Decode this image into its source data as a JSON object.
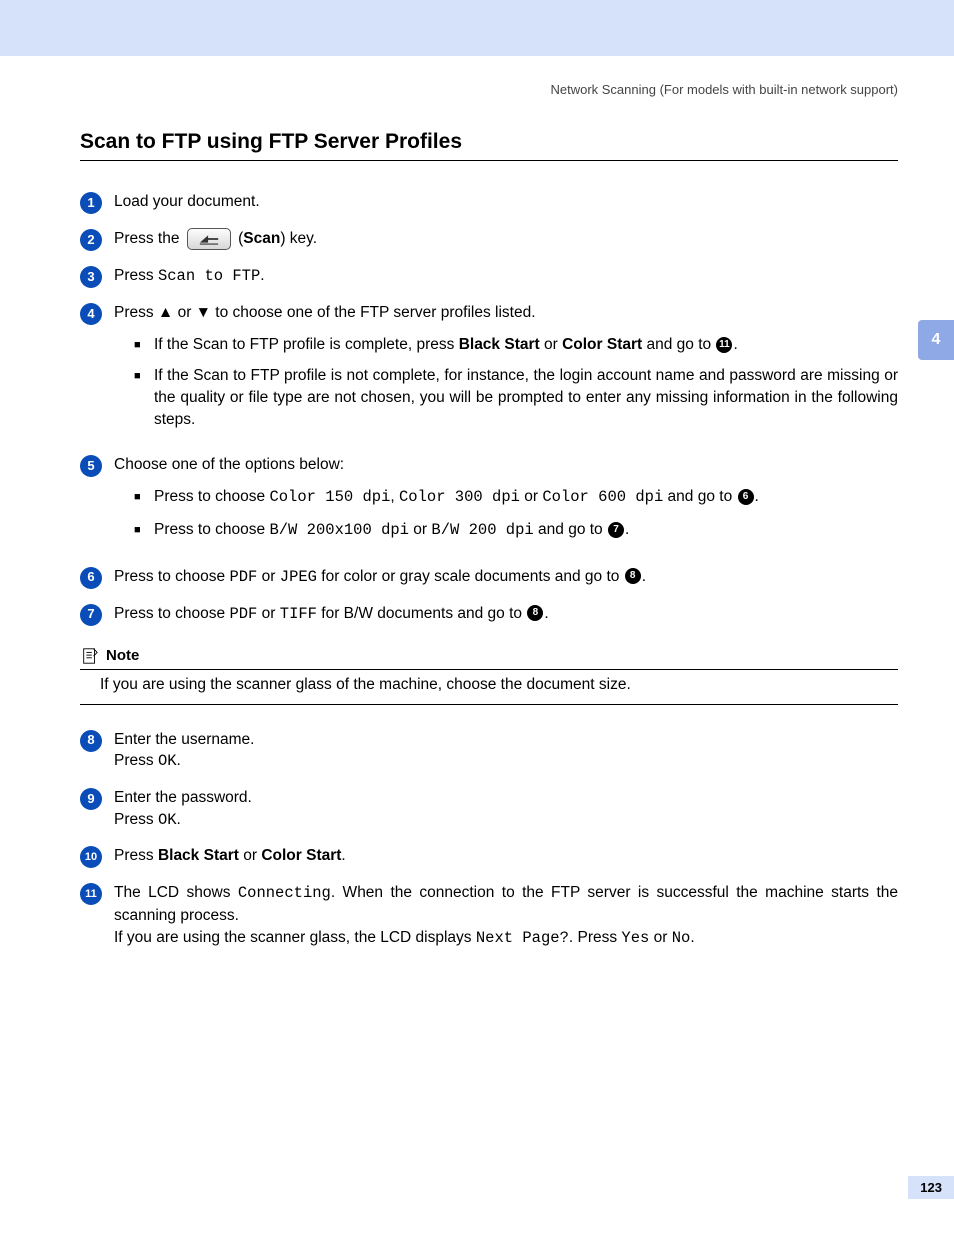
{
  "header": "Network Scanning  (For models with built-in network support)",
  "chapter_tab": "4",
  "page_number": "123",
  "title": "Scan to FTP using FTP Server Profiles",
  "steps": {
    "s1": "Load your document.",
    "s2_a": "Press the ",
    "s2_b": " (",
    "s2_scan": "Scan",
    "s2_c": ") key.",
    "s3_a": "Press ",
    "s3_code": "Scan to FTP",
    "s3_b": ".",
    "s4": "Press ▲ or ▼ to choose one of the FTP server profiles listed.",
    "s4_sub1_a": "If the Scan to FTP profile is complete, press ",
    "s4_sub1_b": "Black Start",
    "s4_sub1_c": " or ",
    "s4_sub1_d": "Color Start",
    "s4_sub1_e": " and go to ",
    "s4_sub1_ref": "⓫",
    "s4_sub1_f": ".",
    "s4_sub2": "If the Scan to FTP profile is not complete, for instance, the login account name and password are missing or the quality or file type are not chosen, you will be prompted to enter any missing information in the following steps.",
    "s5": "Choose one of the options below:",
    "s5_sub1_a": "Press to choose ",
    "s5_sub1_c1": "Color 150 dpi",
    "s5_sub1_b": ", ",
    "s5_sub1_c2": "Color 300 dpi",
    "s5_sub1_c": " or ",
    "s5_sub1_c3": "Color 600 dpi",
    "s5_sub1_d": " and go to ",
    "s5_sub1_ref": "❻",
    "s5_sub1_e": ".",
    "s5_sub2_a": "Press to choose ",
    "s5_sub2_c1": "B/W 200x100 dpi",
    "s5_sub2_b": " or ",
    "s5_sub2_c2": "B/W 200 dpi",
    "s5_sub2_c": " and go to ",
    "s5_sub2_ref": "❼",
    "s5_sub2_d": ".",
    "s6_a": "Press to choose ",
    "s6_c1": "PDF",
    "s6_b": " or ",
    "s6_c2": "JPEG",
    "s6_c": " for color or gray scale documents and go to ",
    "s6_ref": "❽",
    "s6_d": ".",
    "s7_a": "Press to choose ",
    "s7_c1": "PDF",
    "s7_b": " or ",
    "s7_c2": "TIFF",
    "s7_c": " for B/W documents and go to ",
    "s7_ref": "❽",
    "s7_d": ".",
    "note_title": "Note",
    "note_body": "If you are using the scanner glass of the machine, choose the document size.",
    "s8_a": "Enter the username.",
    "s8_b": "Press ",
    "s8_ok": "OK",
    "s8_c": ".",
    "s9_a": "Enter the password.",
    "s9_b": "Press ",
    "s9_ok": "OK",
    "s9_c": ".",
    "s10_a": "Press ",
    "s10_b": "Black Start",
    "s10_c": " or ",
    "s10_d": "Color Start",
    "s10_e": ".",
    "s11_a": "The LCD shows ",
    "s11_c1": "Connecting",
    "s11_b": ". When the connection to the FTP server is successful the machine starts the scanning process.",
    "s11_c": "If you are using the scanner glass, the LCD displays ",
    "s11_c2": "Next Page?",
    "s11_d": ". Press ",
    "s11_c3": "Yes",
    "s11_e": " or ",
    "s11_c4": "No",
    "s11_f": "."
  }
}
